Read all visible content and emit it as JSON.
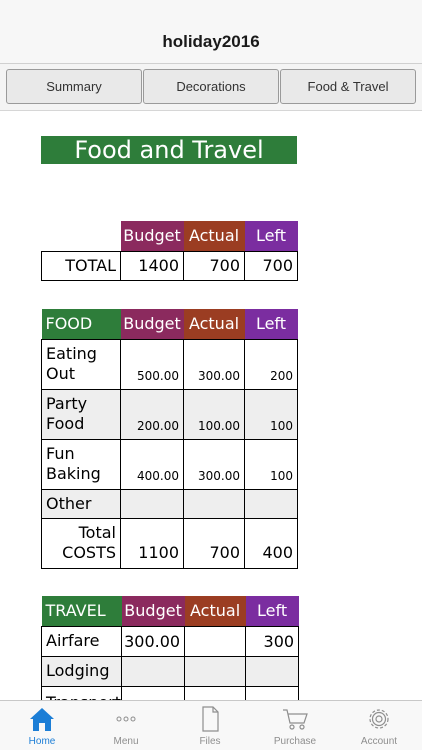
{
  "header": {
    "title": "holiday2016"
  },
  "segments": [
    "Summary",
    "Decorations",
    "Food & Travel"
  ],
  "sheet": {
    "title": "Food and Travel",
    "columns": {
      "budget": "Budget",
      "actual": "Actual",
      "left": "Left"
    },
    "summary": {
      "label": "TOTAL",
      "budget": "1400",
      "actual": "700",
      "left": "700"
    },
    "food": {
      "section": "FOOD",
      "rows": [
        {
          "label_line1": "Eating",
          "label_line2": "Out",
          "budget": "500.00",
          "actual": "300.00",
          "left": "200"
        },
        {
          "label_line1": "Party",
          "label_line2": "Food",
          "budget": "200.00",
          "actual": "100.00",
          "left": "100"
        },
        {
          "label_line1": "Fun",
          "label_line2": "Baking",
          "budget": "400.00",
          "actual": "300.00",
          "left": "100"
        },
        {
          "label_line1": "Other",
          "label_line2": "",
          "budget": "",
          "actual": "",
          "left": ""
        }
      ],
      "total": {
        "label_line1": "Total",
        "label_line2": "COSTS",
        "budget": "1100",
        "actual": "700",
        "left": "400"
      }
    },
    "travel": {
      "section": "TRAVEL",
      "rows": [
        {
          "label": "Airfare",
          "budget": "300.00",
          "actual": "",
          "left": "300"
        },
        {
          "label": "Lodging",
          "budget": "",
          "actual": "",
          "left": ""
        },
        {
          "label": "Transport",
          "budget": "",
          "actual": "",
          "left": ""
        }
      ]
    }
  },
  "tabbar": {
    "active_color": "#1c7ed6",
    "items": [
      {
        "label": "Home",
        "icon": "home-icon"
      },
      {
        "label": "Menu",
        "icon": "more-dots-icon"
      },
      {
        "label": "Files",
        "icon": "document-icon"
      },
      {
        "label": "Purchase",
        "icon": "cart-icon"
      },
      {
        "label": "Account",
        "icon": "gear-icon"
      }
    ]
  }
}
